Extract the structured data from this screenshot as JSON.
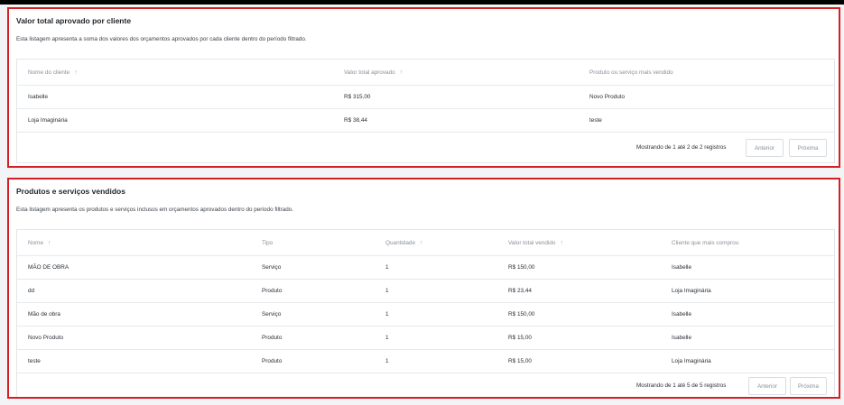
{
  "section1": {
    "title": "Valor total aprovado por cliente",
    "description": "Esta listagem apresenta a soma dos valores dos orçamentos aprovados por cada cliente dentro do período filtrado.",
    "columns": [
      "Nome do cliente",
      "Valor total aprovado",
      "Produto ou serviço mais vendido"
    ],
    "rows": [
      [
        "Isabelle",
        "R$ 315,00",
        "Novo Produto"
      ],
      [
        "Loja Imaginária",
        "R$ 38,44",
        "teste"
      ]
    ],
    "pagination_info": "Mostrando de 1 até 2 de 2 registros",
    "prev_label": "Anterior",
    "next_label": "Próxima"
  },
  "section2": {
    "title": "Produtos e serviços vendidos",
    "description": "Esta listagem apresenta os produtos e serviços inclusos em orçamentos aprovados dentro do período filtrado.",
    "columns": [
      "Nome",
      "Tipo",
      "Quantidade",
      "Valor total vendido",
      "Cliente que mais comprou"
    ],
    "rows": [
      [
        "MÃO DE OBRA",
        "Serviço",
        "1",
        "R$ 150,00",
        "Isabelle"
      ],
      [
        "dd",
        "Produto",
        "1",
        "R$ 23,44",
        "Loja Imaginária"
      ],
      [
        "Mão de obra",
        "Serviço",
        "1",
        "R$ 150,00",
        "Isabelle"
      ],
      [
        "Novo Produto",
        "Produto",
        "1",
        "R$ 15,00",
        "Isabelle"
      ],
      [
        "teste",
        "Produto",
        "1",
        "R$ 15,00",
        "Loja Imaginária"
      ]
    ],
    "pagination_info": "Mostrando de 1 até 5 de 5 registros",
    "prev_label": "Anterior",
    "next_label": "Próxima"
  },
  "icons": {
    "sort": "arrow-up-icon",
    "sort_glyph": "↑"
  },
  "colors": {
    "highlight_border": "#d81e23",
    "muted_text": "#8a9099"
  }
}
